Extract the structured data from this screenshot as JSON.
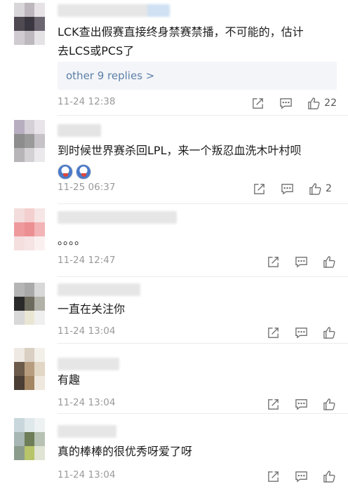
{
  "comments": [
    {
      "text_line1": "LCK查出假赛直接终身禁赛禁播，不可能的，估计",
      "text_line2": "去LCS或PCS了",
      "replies_label": "other 9 replies >",
      "time": "11-24 12:38",
      "likes": "22"
    },
    {
      "text_line1": "到时候世界赛杀回LPL，来一个叛忍血洗木叶村呗",
      "time": "11-25 06:37",
      "likes": "2"
    },
    {
      "text_line1": "。。。。",
      "time": "11-24 12:47",
      "likes": ""
    },
    {
      "text_line1": "一直在关注你",
      "time": "11-24 13:04",
      "likes": ""
    },
    {
      "text_line1": "有趣",
      "time": "11-24 13:04",
      "likes": ""
    },
    {
      "text_line1": "真的棒棒的很优秀呀爱了呀",
      "time": "11-24 13:04",
      "likes": ""
    }
  ],
  "icons": {
    "share": "share-icon",
    "comment": "comment-icon",
    "like": "thumbs-up-icon"
  },
  "colors": {
    "link": "#5b7fa8",
    "meta": "#9a9a9a",
    "reply_bg": "#f4f5f8"
  }
}
